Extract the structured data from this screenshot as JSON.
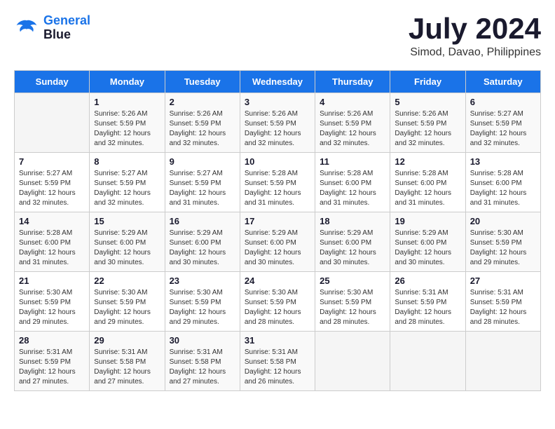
{
  "header": {
    "logo_line1": "General",
    "logo_line2": "Blue",
    "month": "July 2024",
    "location": "Simod, Davao, Philippines"
  },
  "days_of_week": [
    "Sunday",
    "Monday",
    "Tuesday",
    "Wednesday",
    "Thursday",
    "Friday",
    "Saturday"
  ],
  "weeks": [
    [
      {
        "day": "",
        "info": ""
      },
      {
        "day": "1",
        "info": "Sunrise: 5:26 AM\nSunset: 5:59 PM\nDaylight: 12 hours\nand 32 minutes."
      },
      {
        "day": "2",
        "info": "Sunrise: 5:26 AM\nSunset: 5:59 PM\nDaylight: 12 hours\nand 32 minutes."
      },
      {
        "day": "3",
        "info": "Sunrise: 5:26 AM\nSunset: 5:59 PM\nDaylight: 12 hours\nand 32 minutes."
      },
      {
        "day": "4",
        "info": "Sunrise: 5:26 AM\nSunset: 5:59 PM\nDaylight: 12 hours\nand 32 minutes."
      },
      {
        "day": "5",
        "info": "Sunrise: 5:26 AM\nSunset: 5:59 PM\nDaylight: 12 hours\nand 32 minutes."
      },
      {
        "day": "6",
        "info": "Sunrise: 5:27 AM\nSunset: 5:59 PM\nDaylight: 12 hours\nand 32 minutes."
      }
    ],
    [
      {
        "day": "7",
        "info": "Sunrise: 5:27 AM\nSunset: 5:59 PM\nDaylight: 12 hours\nand 32 minutes."
      },
      {
        "day": "8",
        "info": "Sunrise: 5:27 AM\nSunset: 5:59 PM\nDaylight: 12 hours\nand 32 minutes."
      },
      {
        "day": "9",
        "info": "Sunrise: 5:27 AM\nSunset: 5:59 PM\nDaylight: 12 hours\nand 31 minutes."
      },
      {
        "day": "10",
        "info": "Sunrise: 5:28 AM\nSunset: 5:59 PM\nDaylight: 12 hours\nand 31 minutes."
      },
      {
        "day": "11",
        "info": "Sunrise: 5:28 AM\nSunset: 6:00 PM\nDaylight: 12 hours\nand 31 minutes."
      },
      {
        "day": "12",
        "info": "Sunrise: 5:28 AM\nSunset: 6:00 PM\nDaylight: 12 hours\nand 31 minutes."
      },
      {
        "day": "13",
        "info": "Sunrise: 5:28 AM\nSunset: 6:00 PM\nDaylight: 12 hours\nand 31 minutes."
      }
    ],
    [
      {
        "day": "14",
        "info": "Sunrise: 5:28 AM\nSunset: 6:00 PM\nDaylight: 12 hours\nand 31 minutes."
      },
      {
        "day": "15",
        "info": "Sunrise: 5:29 AM\nSunset: 6:00 PM\nDaylight: 12 hours\nand 30 minutes."
      },
      {
        "day": "16",
        "info": "Sunrise: 5:29 AM\nSunset: 6:00 PM\nDaylight: 12 hours\nand 30 minutes."
      },
      {
        "day": "17",
        "info": "Sunrise: 5:29 AM\nSunset: 6:00 PM\nDaylight: 12 hours\nand 30 minutes."
      },
      {
        "day": "18",
        "info": "Sunrise: 5:29 AM\nSunset: 6:00 PM\nDaylight: 12 hours\nand 30 minutes."
      },
      {
        "day": "19",
        "info": "Sunrise: 5:29 AM\nSunset: 6:00 PM\nDaylight: 12 hours\nand 30 minutes."
      },
      {
        "day": "20",
        "info": "Sunrise: 5:30 AM\nSunset: 5:59 PM\nDaylight: 12 hours\nand 29 minutes."
      }
    ],
    [
      {
        "day": "21",
        "info": "Sunrise: 5:30 AM\nSunset: 5:59 PM\nDaylight: 12 hours\nand 29 minutes."
      },
      {
        "day": "22",
        "info": "Sunrise: 5:30 AM\nSunset: 5:59 PM\nDaylight: 12 hours\nand 29 minutes."
      },
      {
        "day": "23",
        "info": "Sunrise: 5:30 AM\nSunset: 5:59 PM\nDaylight: 12 hours\nand 29 minutes."
      },
      {
        "day": "24",
        "info": "Sunrise: 5:30 AM\nSunset: 5:59 PM\nDaylight: 12 hours\nand 28 minutes."
      },
      {
        "day": "25",
        "info": "Sunrise: 5:30 AM\nSunset: 5:59 PM\nDaylight: 12 hours\nand 28 minutes."
      },
      {
        "day": "26",
        "info": "Sunrise: 5:31 AM\nSunset: 5:59 PM\nDaylight: 12 hours\nand 28 minutes."
      },
      {
        "day": "27",
        "info": "Sunrise: 5:31 AM\nSunset: 5:59 PM\nDaylight: 12 hours\nand 28 minutes."
      }
    ],
    [
      {
        "day": "28",
        "info": "Sunrise: 5:31 AM\nSunset: 5:59 PM\nDaylight: 12 hours\nand 27 minutes."
      },
      {
        "day": "29",
        "info": "Sunrise: 5:31 AM\nSunset: 5:58 PM\nDaylight: 12 hours\nand 27 minutes."
      },
      {
        "day": "30",
        "info": "Sunrise: 5:31 AM\nSunset: 5:58 PM\nDaylight: 12 hours\nand 27 minutes."
      },
      {
        "day": "31",
        "info": "Sunrise: 5:31 AM\nSunset: 5:58 PM\nDaylight: 12 hours\nand 26 minutes."
      },
      {
        "day": "",
        "info": ""
      },
      {
        "day": "",
        "info": ""
      },
      {
        "day": "",
        "info": ""
      }
    ]
  ]
}
